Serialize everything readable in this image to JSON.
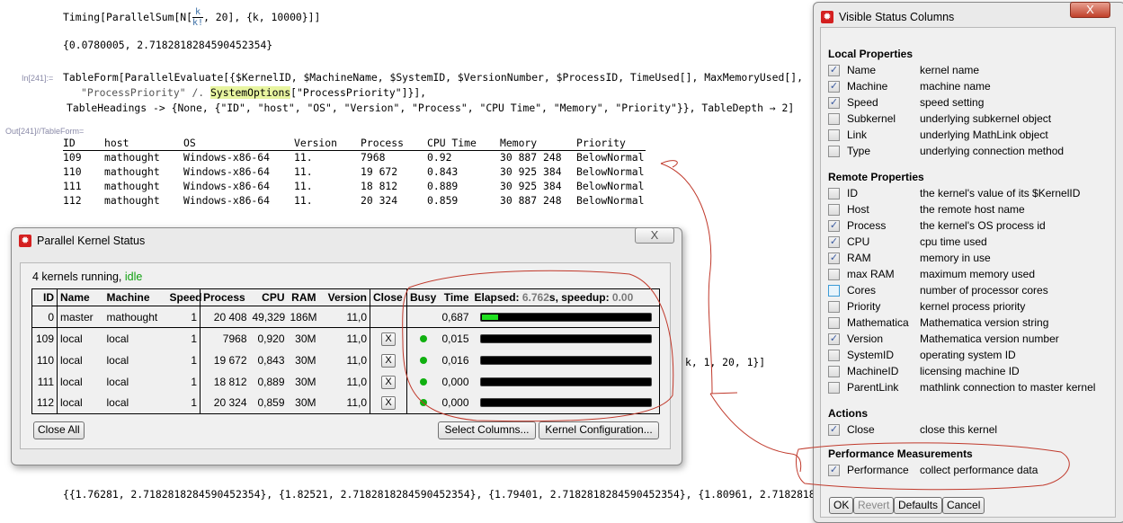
{
  "notebook": {
    "timing_input": {
      "pre": "Timing[ParallelSum[N[",
      "num": "k",
      "den": "k!",
      "post": ", 20], {k, 10000}]]"
    },
    "timing_output": "{0.0780005, 2.7182818284590452354}",
    "in_label": "In[241]:=",
    "input_lines": [
      "TableForm[ParallelEvaluate[{$KernelID, $MachineName, $SystemID, $VersionNumber, $ProcessID, TimeUsed[], MaxMemoryUsed[],",
      "\"ProcessPriority\" /. ",
      "SystemOptions",
      "[\"ProcessPriority\"]}],",
      "TableHeadings -> {None, {\"ID\", \"host\", \"OS\", \"Version\", \"Process\", \"CPU Time\", \"Memory\", \"Priority\"}}, TableDepth → 2]"
    ],
    "out_label": "Out[241]//TableForm=",
    "table": {
      "headers": [
        "ID",
        "host",
        "OS",
        "Version",
        "Process",
        "CPU Time",
        "Memory",
        "Priority"
      ],
      "rows": [
        [
          "109",
          "mathought",
          "Windows-x86-64",
          "11.",
          "7968",
          "0.92",
          "30 887 248",
          "BelowNormal"
        ],
        [
          "110",
          "mathought",
          "Windows-x86-64",
          "11.",
          "19 672",
          "0.843",
          "30 925 384",
          "BelowNormal"
        ],
        [
          "111",
          "mathought",
          "Windows-x86-64",
          "11.",
          "18 812",
          "0.889",
          "30 925 384",
          "BelowNormal"
        ],
        [
          "112",
          "mathought",
          "Windows-x86-64",
          "11.",
          "20 324",
          "0.859",
          "30 887 248",
          "BelowNormal"
        ]
      ]
    },
    "partial_right": "k, 1, 20, 1}]",
    "bottom_output": "{{1.76281, 2.7182818284590452354}, {1.82521, 2.7182818284590452354}, {1.79401, 2.7182818284590452354}, {1.80961, 2.71828182"
  },
  "kernel_status": {
    "title": "Parallel Kernel Status",
    "close_glyph": "X",
    "status_prefix": "4 kernels running, ",
    "status_state": "idle",
    "status_color": "#10a010",
    "headers": {
      "id": "ID",
      "name": "Name",
      "machine": "Machine",
      "speed": "Speed",
      "process": "Process",
      "cpu": "CPU",
      "ram": "RAM",
      "version": "Version",
      "close": "Close",
      "busy": "Busy",
      "time": "Time",
      "elapsed_label": "Elapsed: ",
      "elapsed": "6.762",
      "elapsed_unit": "s, speedup: ",
      "speedup": "0.00"
    },
    "rows": [
      {
        "id": "0",
        "name": "master",
        "machine": "mathought",
        "speed": "1",
        "process": "20 408",
        "cpu": "49,329",
        "ram": "186M",
        "version": "11,0",
        "closable": false,
        "busy": false,
        "time": "0,687",
        "load": 0.1
      },
      {
        "id": "109",
        "name": "local",
        "machine": "local",
        "speed": "1",
        "process": "7968",
        "cpu": "0,920",
        "ram": "30M",
        "version": "11,0",
        "closable": true,
        "busy": true,
        "time": "0,015",
        "load": 0
      },
      {
        "id": "110",
        "name": "local",
        "machine": "local",
        "speed": "1",
        "process": "19 672",
        "cpu": "0,843",
        "ram": "30M",
        "version": "11,0",
        "closable": true,
        "busy": true,
        "time": "0,016",
        "load": 0
      },
      {
        "id": "111",
        "name": "local",
        "machine": "local",
        "speed": "1",
        "process": "18 812",
        "cpu": "0,889",
        "ram": "30M",
        "version": "11,0",
        "closable": true,
        "busy": true,
        "time": "0,000",
        "load": 0
      },
      {
        "id": "112",
        "name": "local",
        "machine": "local",
        "speed": "1",
        "process": "20 324",
        "cpu": "0,859",
        "ram": "30M",
        "version": "11,0",
        "closable": true,
        "busy": true,
        "time": "0,000",
        "load": 0
      }
    ],
    "close_x": "X",
    "buttons": {
      "close_all": "Close All",
      "select_columns": "Select Columns...",
      "kernel_config": "Kernel Configuration..."
    }
  },
  "visible_columns": {
    "title": "Visible Status Columns",
    "close_glyph": "X",
    "sections": [
      {
        "title": "Local Properties",
        "items": [
          {
            "name": "Name",
            "desc": "kernel name",
            "checked": true
          },
          {
            "name": "Machine",
            "desc": "machine name",
            "checked": true
          },
          {
            "name": "Speed",
            "desc": "speed setting",
            "checked": true
          },
          {
            "name": "Subkernel",
            "desc": "underlying subkernel object",
            "checked": false
          },
          {
            "name": "Link",
            "desc": "underlying MathLink object",
            "checked": false
          },
          {
            "name": "Type",
            "desc": "underlying connection method",
            "checked": false
          }
        ]
      },
      {
        "title": "Remote Properties",
        "items": [
          {
            "name": "ID",
            "desc": "the kernel's value of its $KernelID",
            "checked": false
          },
          {
            "name": "Host",
            "desc": "the remote host name",
            "checked": false
          },
          {
            "name": "Process",
            "desc": "the kernel's OS process id",
            "checked": true
          },
          {
            "name": "CPU",
            "desc": "cpu time used",
            "checked": true
          },
          {
            "name": "RAM",
            "desc": "memory in use",
            "checked": true
          },
          {
            "name": "max RAM",
            "desc": "maximum memory used",
            "checked": false
          },
          {
            "name": "Cores",
            "desc": "number of processor cores",
            "checked": false,
            "hover": true
          },
          {
            "name": "Priority",
            "desc": "kernel process priority",
            "checked": false
          },
          {
            "name": "Mathematica",
            "desc": "Mathematica version string",
            "checked": false
          },
          {
            "name": "Version",
            "desc": "Mathematica version number",
            "checked": true
          },
          {
            "name": "SystemID",
            "desc": "operating system ID",
            "checked": false
          },
          {
            "name": "MachineID",
            "desc": "licensing machine ID",
            "checked": false
          },
          {
            "name": "ParentLink",
            "desc": "mathlink connection to master kernel",
            "checked": false
          }
        ]
      },
      {
        "title": "Actions",
        "items": [
          {
            "name": "Close",
            "desc": "close this kernel",
            "checked": true
          }
        ]
      },
      {
        "title": "Performance Measurements",
        "items": [
          {
            "name": "Performance",
            "desc": "collect performance data",
            "checked": true
          }
        ]
      }
    ],
    "buttons": {
      "ok": "OK",
      "revert": "Revert",
      "defaults": "Defaults",
      "cancel": "Cancel"
    }
  },
  "colors": {
    "annotation": "#c0392b",
    "accent_green": "#20e020",
    "logo_red": "#d42020"
  }
}
